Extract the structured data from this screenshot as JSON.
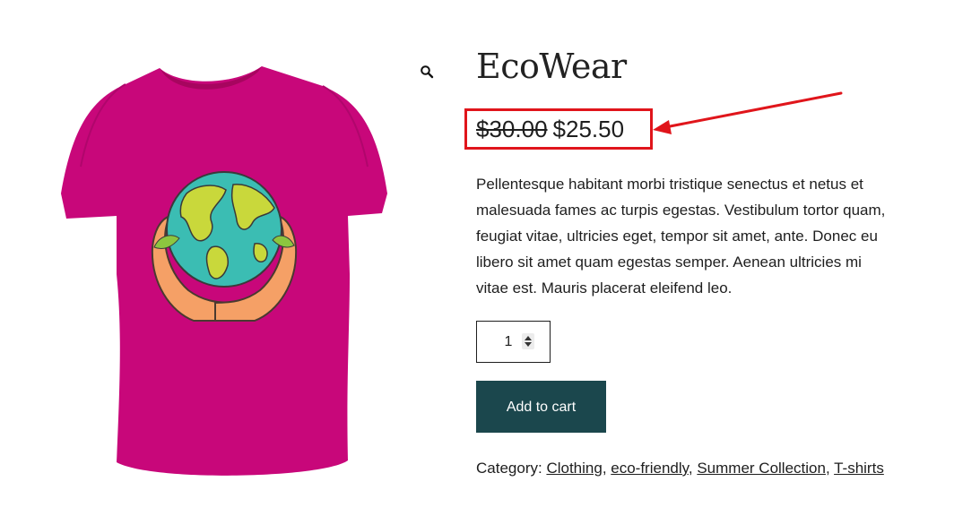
{
  "product": {
    "title": "EcoWear",
    "price_old": "$30.00",
    "price_new": "$25.50",
    "description": "Pellentesque habitant morbi tristique senectus et netus et malesuada fames ac turpis egestas. Vestibulum tortor quam, feugiat vitae, ultricies eget, tempor sit amet, ante. Donec eu libero sit amet quam egestas semper. Aenean ultricies mi vitae est. Mauris placerat eleifend leo.",
    "quantity": "1",
    "add_to_cart_label": "Add to cart",
    "category_label": "Category:",
    "categories": [
      "Clothing",
      "eco-friendly",
      "Summer Collection",
      "T-shirts"
    ],
    "image_icon": "tshirt-earth-hands-image"
  },
  "icons": {
    "zoom": "magnifier-icon"
  },
  "colors": {
    "button_bg": "#1b474d",
    "annotation": "#e0151b",
    "shirt": "#c8077a"
  }
}
